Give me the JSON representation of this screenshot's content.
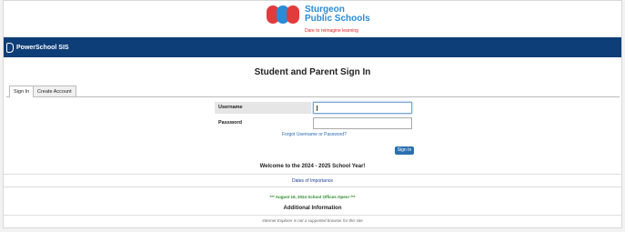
{
  "district": {
    "name_line1": "Sturgeon",
    "name_line2": "Public Schools",
    "tagline": "Dare to reimagine learning"
  },
  "header": {
    "app_name": "PowerSchool SIS"
  },
  "page": {
    "title": "Student and Parent Sign In"
  },
  "tabs": [
    {
      "label": "Sign In",
      "active": true
    },
    {
      "label": "Create Account",
      "active": false
    }
  ],
  "form": {
    "username_label": "Username",
    "password_label": "Password",
    "forgot_link": "Forgot Username or Password?",
    "signin_button": "Sign In"
  },
  "info": {
    "welcome": "Welcome to the 2024 - 2025 School Year!",
    "dates_link": "Dates of Importance",
    "announcement": "*** August 19, 2024 School Offices Open! ***",
    "additional_heading": "Additional Information",
    "ie_notice": "Internet Explorer is not a supported browser for this site"
  },
  "colors": {
    "header_bar": "#0d3e78",
    "accent": "#2a6fb0",
    "announcement": "#2d8a2d",
    "tagline": "#dd2222"
  }
}
